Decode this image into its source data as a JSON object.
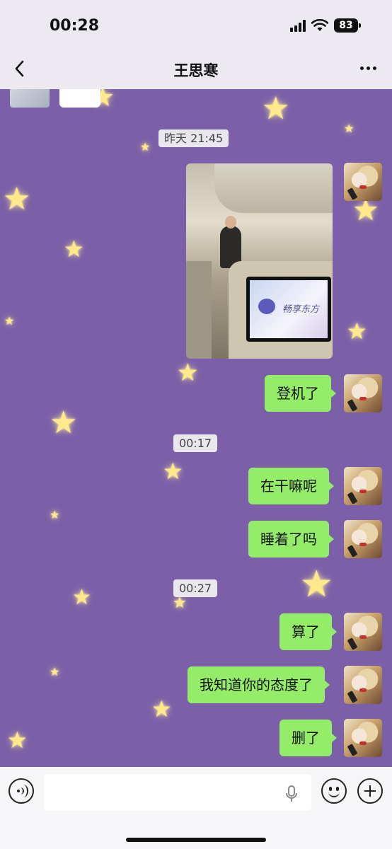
{
  "status_bar": {
    "time": "00:28",
    "battery": "83",
    "signal_icon": "cellular-signal-icon",
    "wifi_icon": "wifi-icon"
  },
  "nav": {
    "back_icon": "chevron-left-icon",
    "title": "王思寒",
    "more_icon": "more-dots-icon"
  },
  "chat": {
    "timestamps": [
      "昨天 21:45",
      "00:17",
      "00:27"
    ],
    "messages": [
      "登机了",
      "在干嘛呢",
      "睡着了吗",
      "算了",
      "我知道你的态度了",
      "删了"
    ],
    "bubble_color": "#95ec69",
    "background_color": "#7b5fa8"
  },
  "photo_message": {
    "screen_text": "畅享东方"
  },
  "input_bar": {
    "voice_icon": "voice-icon",
    "mic_icon": "microphone-icon",
    "emoji_icon": "emoji-icon",
    "plus_icon": "plus-icon"
  }
}
